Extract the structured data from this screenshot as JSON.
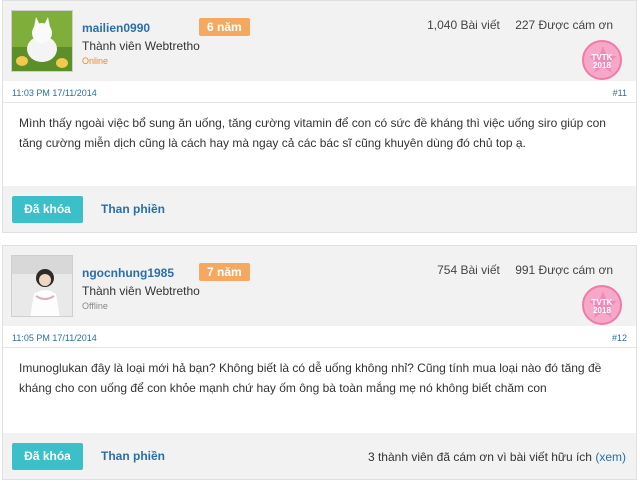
{
  "posts": [
    {
      "username": "mailien0990",
      "badge": "6 năm",
      "title": "Thành viên Webtretho",
      "status": "Online",
      "posts_count": "1,040 Bài viết",
      "thanks_count": "227 Được cám ơn",
      "award_line1": "TVTK",
      "award_line2": "2018",
      "time": "11:03 PM 17/11/2014",
      "number": "#11",
      "content": "Mình thấy ngoài việc bổ sung ăn uống, tăng cường vitamin để con có sức đề kháng thì việc uống siro giúp con tăng cường miễn dịch cũng là cách hay mà ngay cả các bác sĩ cũng khuyên dùng đó chủ top ạ.",
      "locked_label": "Đã khóa",
      "report_label": "Than phiền"
    },
    {
      "username": "ngocnhung1985",
      "badge": "7 năm",
      "title": "Thành viên Webtretho",
      "status": "Offline",
      "posts_count": "754 Bài viết",
      "thanks_count": "991 Được cám ơn",
      "award_line1": "TVTK",
      "award_line2": "2018",
      "time": "11:05 PM 17/11/2014",
      "number": "#12",
      "content": "Imunoglukan đây là loại mới hả bạn? Không biết là có dễ uống không nhỉ? Cũng tính mua loại nào đó tăng đề kháng cho con uống để con khỏe mạnh chứ hay ốm ông bà toàn mắng mẹ nó không biết chăm con",
      "locked_label": "Đã khóa",
      "report_label": "Than phiền",
      "thanks_text": "3 thành viên đã cám ơn vì bài viết hữu ích",
      "thanks_link": "(xem)"
    }
  ],
  "colors": {
    "accent": "#3bbfc9",
    "link": "#2a6fa8",
    "badge": "#f4a860",
    "award": "#f6a8c8"
  }
}
